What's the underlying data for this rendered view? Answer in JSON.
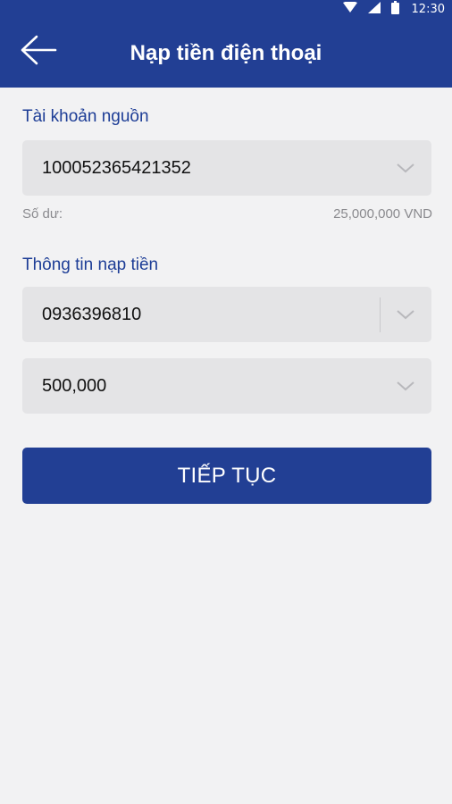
{
  "status_bar": {
    "time": "12:30",
    "icons": [
      "wifi-icon",
      "signal-icon",
      "battery-icon"
    ]
  },
  "header": {
    "title": "Nạp tiền điện thoại",
    "back_icon": "arrow-left-icon"
  },
  "source_account": {
    "label": "Tài khoản nguồn",
    "account_number": "100052365421352",
    "balance_label": "Số dư:",
    "balance_value": "25,000,000 VND"
  },
  "topup_info": {
    "label": "Thông tin nạp tiền",
    "phone_number": "0936396810",
    "amount": "500,000"
  },
  "actions": {
    "continue_label": "TIẾP TỤC"
  },
  "colors": {
    "primary": "#223f94",
    "label_blue": "#1d3d96",
    "background": "#f2f2f3",
    "field_bg": "#e4e4e6",
    "muted_text": "#8a8a8e"
  }
}
